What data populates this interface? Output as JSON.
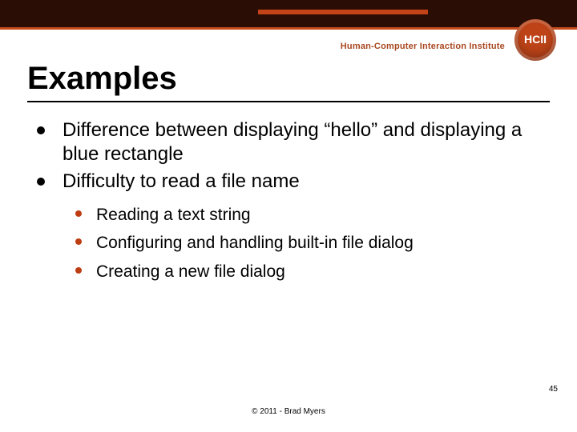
{
  "colors": {
    "brand_dark": "#2a0d05",
    "brand_orange": "#c54a1a",
    "sub_bullet": "#be3c12"
  },
  "header": {
    "org_label": "Human-Computer Interaction Institute",
    "seal_text": "HCII"
  },
  "title": "Examples",
  "bullets": [
    {
      "text": "Difference between displaying “hello” and displaying a blue rectangle"
    },
    {
      "text": "Difficulty to read a file name"
    }
  ],
  "sub_bullets": [
    {
      "text": "Reading a text string"
    },
    {
      "text": "Configuring and handling built-in file dialog"
    },
    {
      "text": "Creating a new file dialog"
    }
  ],
  "page_number": "45",
  "footer": "© 2011 - Brad Myers"
}
